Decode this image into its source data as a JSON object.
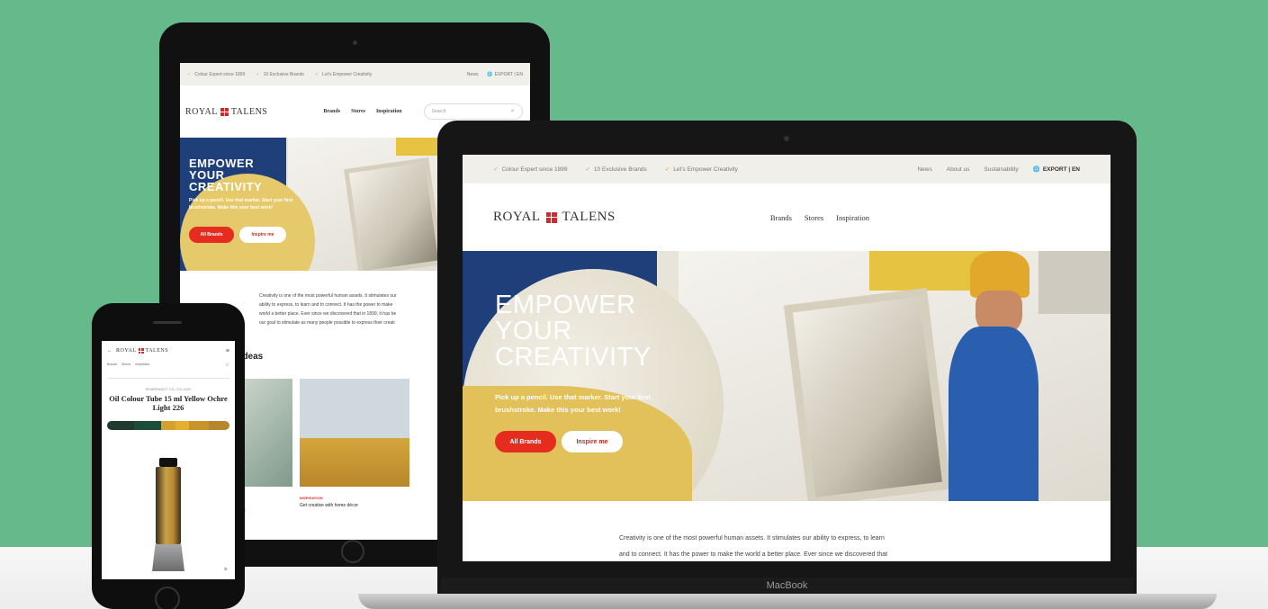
{
  "topbar": {
    "items": [
      "Colour Expert since 1899",
      "10 Exclusive Brands",
      "Let's Empower Creativity"
    ],
    "links": [
      "News",
      "About us",
      "Sustainability"
    ],
    "region": "EXPORT | EN"
  },
  "tablet_topbar": {
    "items": [
      "Colour Expert since 1899",
      "10 Exclusive Brands",
      "Let's Empower Creativity"
    ],
    "links": [
      "News"
    ],
    "region": "EXPORT | EN"
  },
  "brand": {
    "left": "ROYAL",
    "right": "TALENS",
    "accent": "#d7262c"
  },
  "nav": {
    "brands": "Brands",
    "stores": "Stores",
    "inspiration": "Inspiration"
  },
  "search": {
    "placeholder": "Search"
  },
  "hero": {
    "title_lines": [
      "EMPOWER",
      "YOUR",
      "CREATIVITY"
    ],
    "subtitle_lines": [
      "Pick up a pencil. Use that marker. Start your first",
      "brushstroke. Make this your best work!"
    ],
    "btn_primary": "All Brands",
    "btn_secondary": "Inspire me"
  },
  "intro": {
    "lines": [
      "Creativity is one of the most powerful human assets. It stimulates our ability to express, to learn",
      "and to connect. It has the power to make the world a better place. Ever since we discovered that"
    ]
  },
  "tablet_intro": {
    "lines": [
      "Creativity is one of the most powerful human assets. It stimulates our",
      "ability to express, to learn and to connect. It has the power to make",
      "world a better place. Ever since we discovered that in 1899, it has be",
      "our goal to stimulate as many people possible to express their creati"
    ]
  },
  "tablet_section": {
    "title": "r ideas"
  },
  "tablet_cards": [
    {
      "category": "",
      "title": "Get creative with home décor",
      "line1": "all",
      "line2": "ethod"
    },
    {
      "category": "INSPIRATION",
      "title": "Get creative with home décor"
    }
  ],
  "phone": {
    "menu": [
      "Brands",
      "Stores",
      "Inspiration"
    ],
    "breadcrumb": "REMBRANDT OIL COLOUR",
    "product_title": "Oil Colour Tube 15 ml Yellow Ochre Light 226",
    "swatches": [
      "#1f3a2e",
      "#1b4d3a",
      "#d5a12a",
      "#e5b12c",
      "#c99528",
      "#b7862a"
    ]
  },
  "device_label": "MacBook",
  "colors": {
    "green_bg": "#66b98a",
    "red": "#e52c1f",
    "navy": "#1f3f7a",
    "yellow": "#e9c23b"
  }
}
